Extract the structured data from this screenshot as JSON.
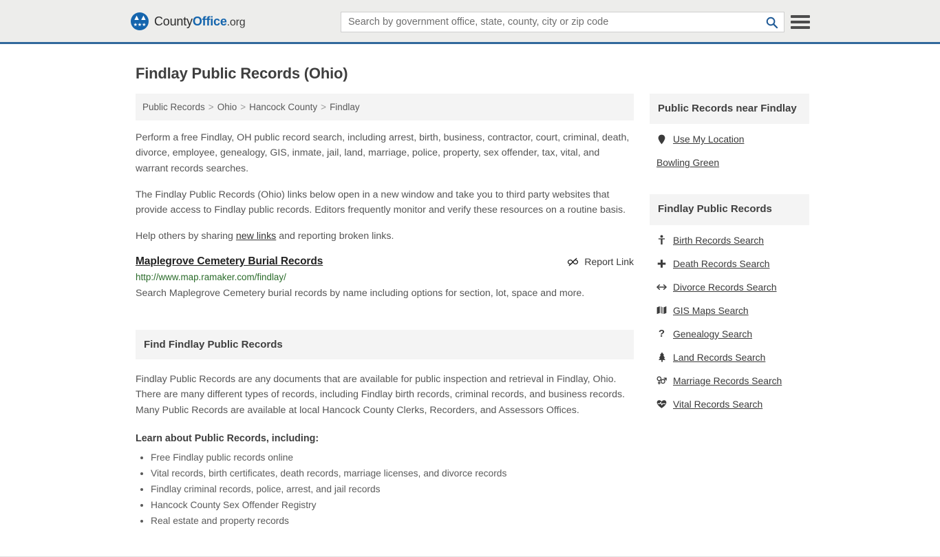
{
  "header": {
    "logo": {
      "name_part1": "County",
      "name_part2": "Office",
      "name_part3": ".org",
      "mark_icon": "eagle-emblem-icon"
    },
    "search": {
      "placeholder": "Search by government office, state, county, city or zip code",
      "value": "",
      "button_icon": "search-icon"
    },
    "menu_icon": "hamburger-menu-icon",
    "accent_color": "#31699c",
    "background_color": "#ededeb"
  },
  "page": {
    "title": "Findlay Public Records (Ohio)"
  },
  "breadcrumb": {
    "items": [
      {
        "label": "Public Records",
        "current": false
      },
      {
        "label": "Ohio",
        "current": false
      },
      {
        "label": "Hancock County",
        "current": false
      },
      {
        "label": "Findlay",
        "current": true
      }
    ],
    "separator": ">"
  },
  "intro": {
    "paragraph1": "Perform a free Findlay, OH public record search, including arrest, birth, business, contractor, court, criminal, death, divorce, employee, genealogy, GIS, inmate, jail, land, marriage, police, property, sex offender, tax, vital, and warrant records searches.",
    "paragraph2": "The Findlay Public Records (Ohio) links below open in a new window and take you to third party websites that provide access to Findlay public records. Editors frequently monitor and verify these resources on a routine basis.",
    "paragraph3_before": "Help others by sharing ",
    "paragraph3_link": "new links",
    "paragraph3_after": " and reporting broken links."
  },
  "result": {
    "title": "Maplegrove Cemetery Burial Records",
    "url": "http://www.map.ramaker.com/findlay/",
    "description": "Search Maplegrove Cemetery burial records by name including options for section, lot, space and more.",
    "report_label": "Report Link",
    "report_icon": "broken-link-icon",
    "url_color": "#2a6b2a"
  },
  "find_section": {
    "heading": "Find Findlay Public Records",
    "body": "Findlay Public Records are any documents that are available for public inspection and retrieval in Findlay, Ohio. There are many different types of records, including Findlay birth records, criminal records, and business records. Many Public Records are available at local Hancock County Clerks, Recorders, and Assessors Offices.",
    "learn_title": "Learn about Public Records, including:",
    "learn_items": [
      "Free Findlay public records online",
      "Vital records, birth certificates, death records, marriage licenses, and divorce records",
      "Findlay criminal records, police, arrest, and jail records",
      "Hancock County Sex Offender Registry",
      "Real estate and property records"
    ]
  },
  "sidebar": {
    "near_panel": {
      "heading": "Public Records near Findlay",
      "items": [
        {
          "label": "Use My Location",
          "icon": "map-pin-icon",
          "has_icon": true
        },
        {
          "label": "Bowling Green",
          "icon": "",
          "has_icon": false
        }
      ]
    },
    "records_panel": {
      "heading": "Findlay Public Records",
      "items": [
        {
          "label": "Birth Records Search",
          "icon": "baby-icon"
        },
        {
          "label": "Death Records Search",
          "icon": "cross-icon"
        },
        {
          "label": "Divorce Records Search",
          "icon": "left-right-arrow-icon"
        },
        {
          "label": "GIS Maps Search",
          "icon": "folded-map-icon"
        },
        {
          "label": "Genealogy Search",
          "icon": "question-mark-icon"
        },
        {
          "label": "Land Records Search",
          "icon": "tree-icon"
        },
        {
          "label": "Marriage Records Search",
          "icon": "male-female-symbol-icon"
        },
        {
          "label": "Vital Records Search",
          "icon": "heart-pulse-icon"
        }
      ]
    }
  }
}
